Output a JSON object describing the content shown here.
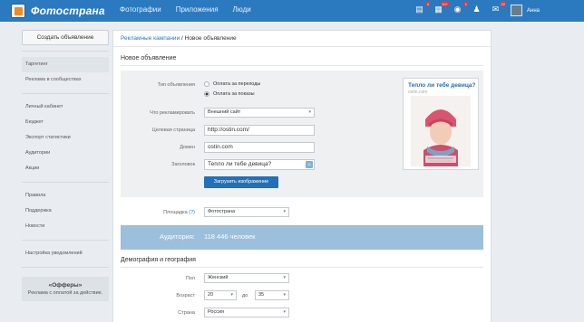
{
  "topbar": {
    "brand": "Фотострана",
    "nav": [
      "Фотографии",
      "Приложения",
      "Люди"
    ],
    "icons": [
      {
        "name": "messages-icon",
        "glyph": "▤",
        "badge": "4"
      },
      {
        "name": "events-icon",
        "glyph": "▦",
        "badge": "10+"
      },
      {
        "name": "gifts-icon",
        "glyph": "◉",
        "badge": "1"
      },
      {
        "name": "friends-icon",
        "glyph": "♟",
        "badge": ""
      },
      {
        "name": "mail-icon",
        "glyph": "✉",
        "badge": "22"
      }
    ],
    "user_name": "Анна"
  },
  "sidebar": {
    "create_button": "Создать объявление",
    "groups": [
      [
        "Таргетинг",
        "Реклама в сообществах"
      ],
      [
        "Личный кабинет",
        "Бюджет",
        "Экспорт статистики",
        "Аудитории",
        "Акции"
      ],
      [
        "Правила",
        "Поддержка",
        "Новости"
      ],
      [
        "Настройка уведомлений"
      ]
    ],
    "active_item": "Таргетинг",
    "offers_title": "«Офферы»",
    "offers_subtitle": "Реклама с оплатой за действие."
  },
  "main": {
    "breadcrumb_link": "Рекламные кампании",
    "breadcrumb_sep": " / ",
    "breadcrumb_current": "Новое объявление",
    "section_title": "Новое объявление",
    "form": {
      "type_label": "Тип объявления",
      "type_options": [
        "Оплата за переходы",
        "Оплата за показы"
      ],
      "type_selected": 1,
      "what_label": "Что рекламировать",
      "what_value": "Внешний сайт",
      "target_label": "Целевая страница",
      "target_value": "http://ostin.com/",
      "domain_label": "Домен",
      "domain_value": "ostin.com",
      "headline_label": "Заголовок",
      "headline_value": "Тепло ли тебе девица?",
      "upload_button": "Загрузить изображение"
    },
    "preview": {
      "title": "Тепло ли тебе девица?",
      "domain": "ostin.com"
    },
    "placement_label": "Площадка",
    "placement_help": "(?)",
    "placement_value": "Фотострана",
    "audience_label": "Аудитория:",
    "audience_value": "118 446 человек",
    "demo_title": "Демография и география",
    "gender_label": "Пол",
    "gender_value": "Женский",
    "age_label": "Возраст",
    "age_from": "20",
    "age_to_word": "до",
    "age_to": "35",
    "country_label": "Страна",
    "country_value": "Россия"
  },
  "colors": {
    "brand_blue": "#2b7ac0",
    "button_blue": "#2270b8",
    "audience_bar": "#9cbfdc"
  }
}
